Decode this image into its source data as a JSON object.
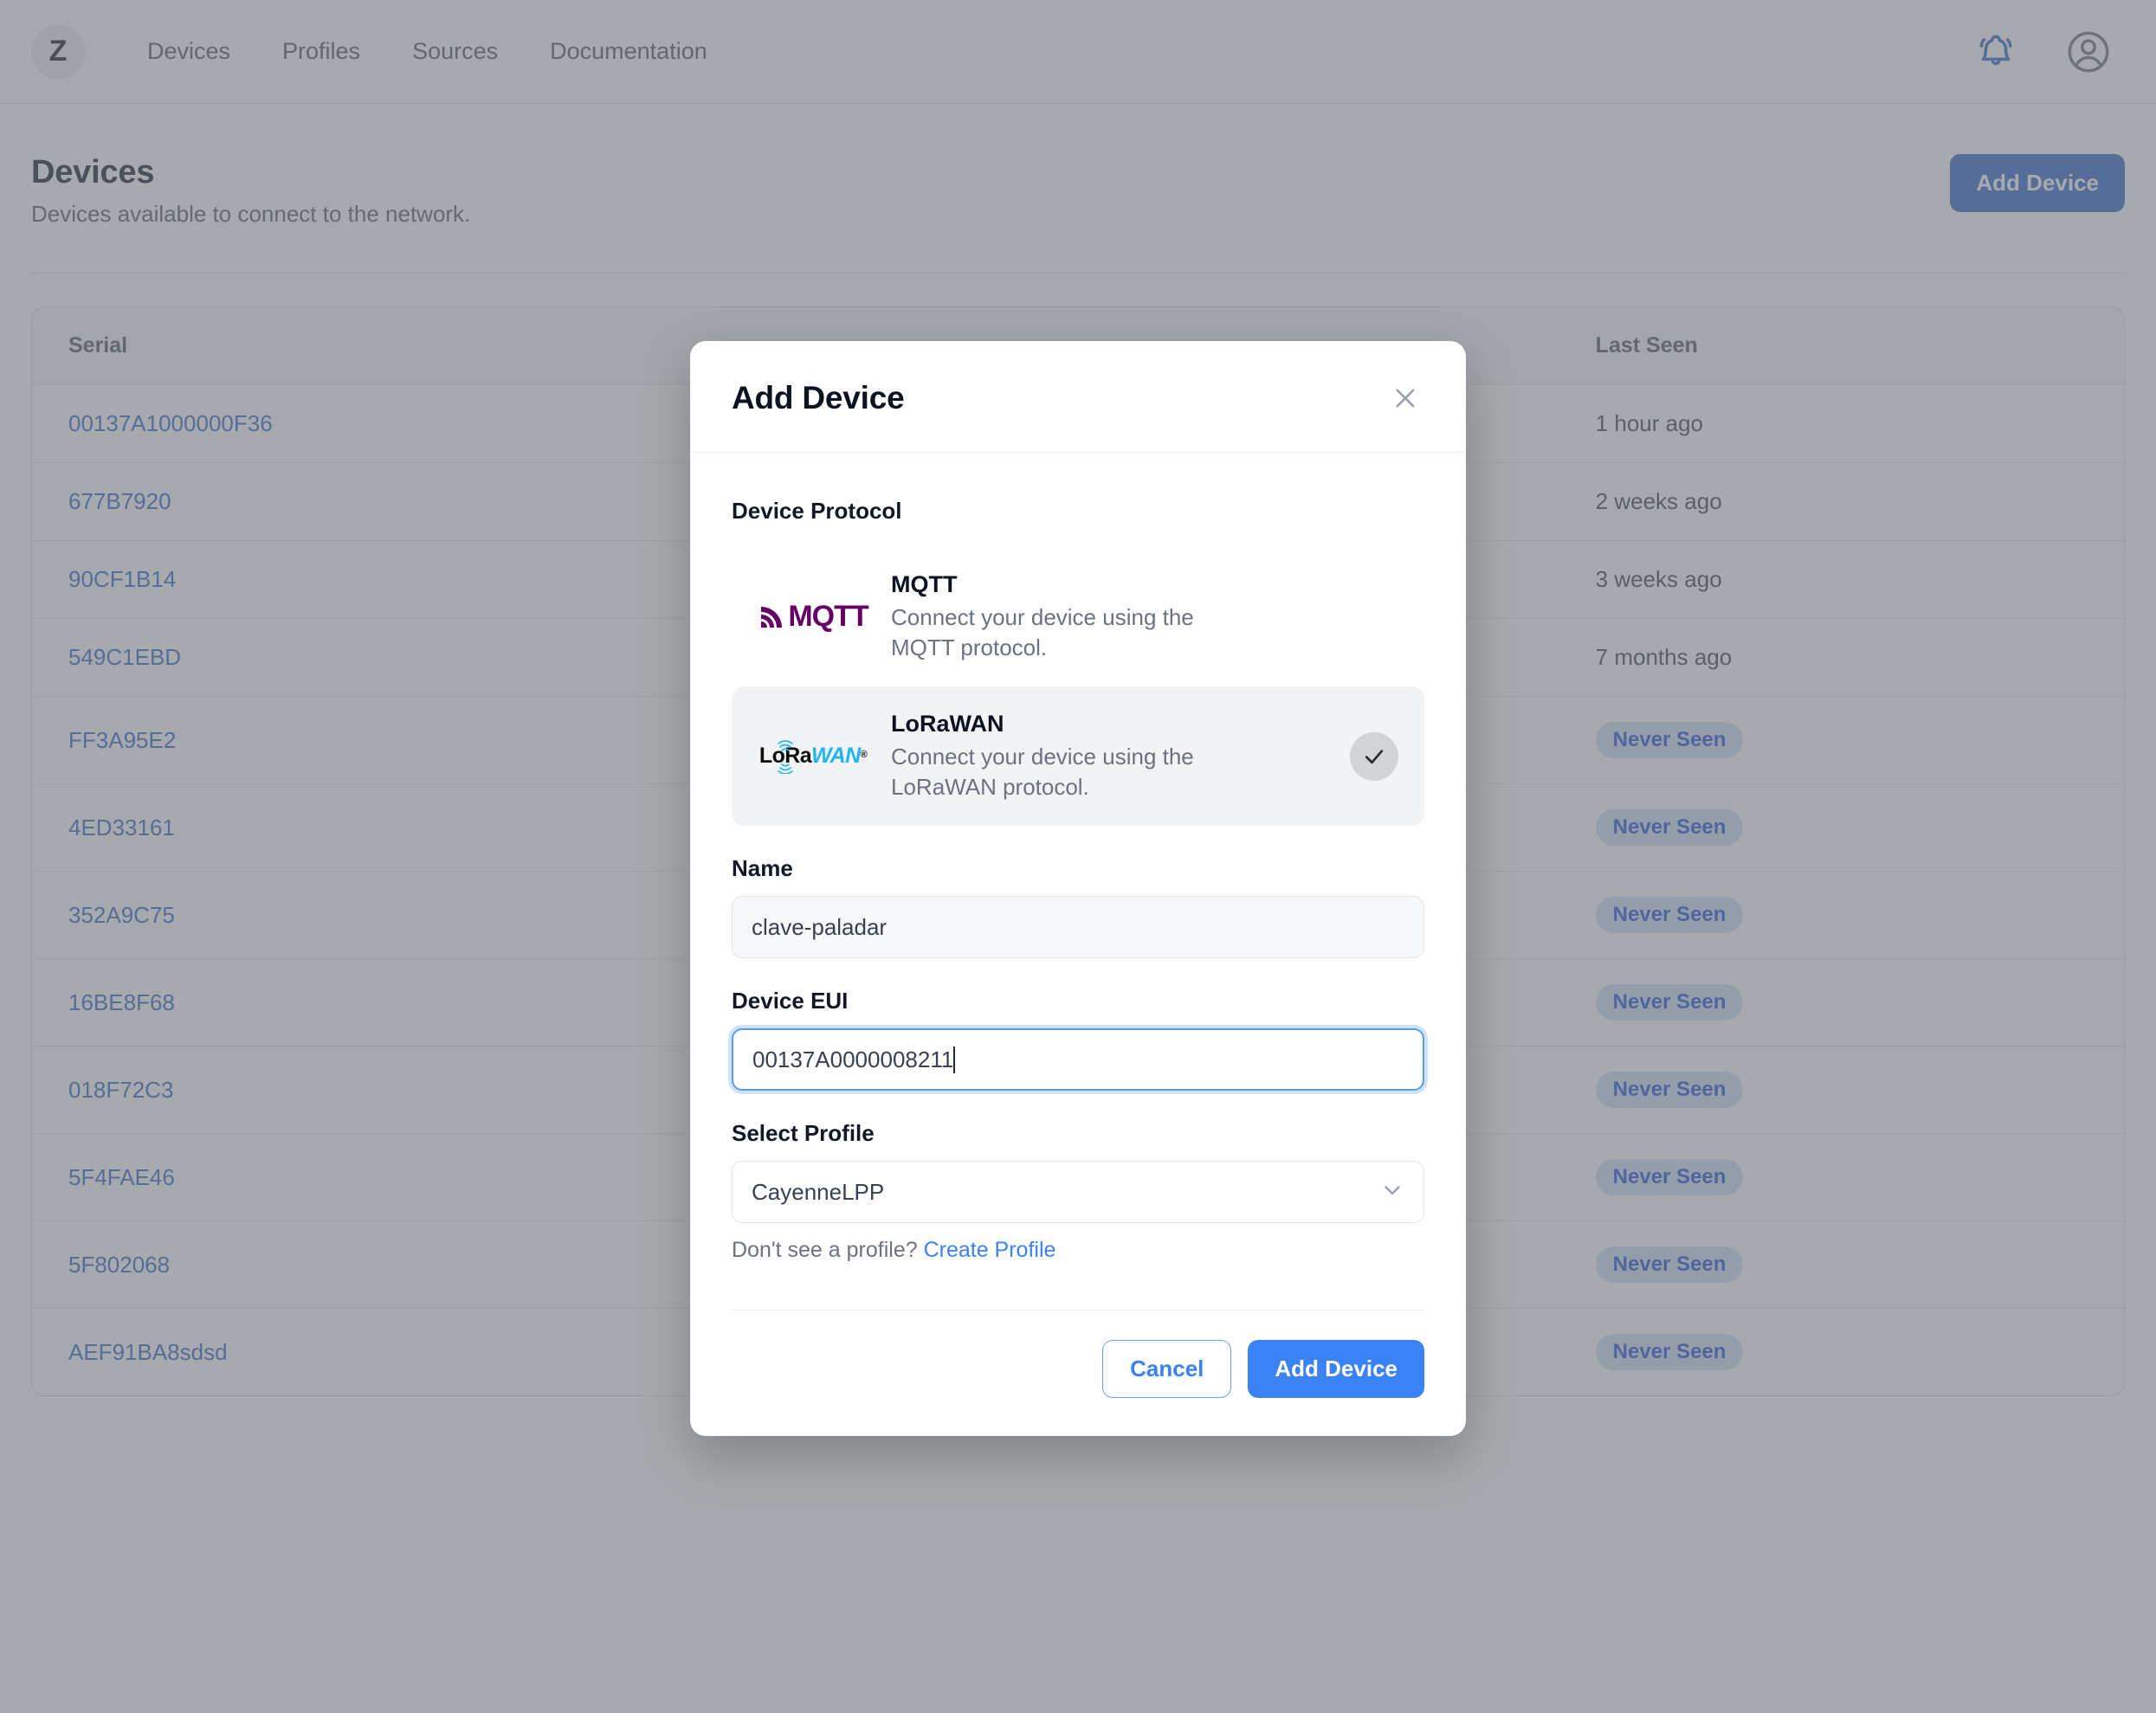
{
  "navbar": {
    "logo_text": "Z",
    "links": [
      {
        "label": "Devices"
      },
      {
        "label": "Profiles"
      },
      {
        "label": "Sources"
      },
      {
        "label": "Documentation"
      }
    ],
    "notifications_icon": "bell-icon",
    "account_icon": "user-circle-icon",
    "notifications_color": "#2f63c4",
    "account_color": "#6b7280"
  },
  "page": {
    "title": "Devices",
    "subtitle": "Devices available to connect to the network.",
    "add_device_label": "Add Device",
    "accent_color": "#2f63c4"
  },
  "table": {
    "columns": [
      "Serial",
      "",
      "Last Seen"
    ],
    "rows": [
      {
        "serial": "00137A1000000F36",
        "last_seen": "1 hour ago",
        "never": false
      },
      {
        "serial": "677B7920",
        "last_seen": "2 weeks ago",
        "never": false
      },
      {
        "serial": "90CF1B14",
        "last_seen": "3 weeks ago",
        "never": false
      },
      {
        "serial": "549C1EBD",
        "last_seen": "7 months ago",
        "never": false
      },
      {
        "serial": "FF3A95E2",
        "last_seen": "Never Seen",
        "never": true
      },
      {
        "serial": "4ED33161",
        "last_seen": "Never Seen",
        "never": true
      },
      {
        "serial": "352A9C75",
        "last_seen": "Never Seen",
        "never": true
      },
      {
        "serial": "16BE8F68",
        "last_seen": "Never Seen",
        "never": true
      },
      {
        "serial": "018F72C3",
        "last_seen": "Never Seen",
        "never": true
      },
      {
        "serial": "5F4FAE46",
        "last_seen": "Never Seen",
        "never": true
      },
      {
        "serial": "5F802068",
        "last_seen": "Never Seen",
        "never": true
      },
      {
        "serial": "AEF91BA8sdsd",
        "last_seen": "Never Seen",
        "never": true
      }
    ],
    "badge_bg": "#cfe0f7",
    "badge_color": "#1d4ed8",
    "link_color": "#2f63c4"
  },
  "modal": {
    "title": "Add Device",
    "close_icon": "close-icon",
    "protocol_label": "Device Protocol",
    "protocols": [
      {
        "name": "MQTT",
        "description": "Connect your device using the MQTT protocol.",
        "logo": "mqtt-logo",
        "logo_color": "#660066",
        "selected": false
      },
      {
        "name": "LoRaWAN",
        "description": "Connect your device using the LoRaWAN protocol.",
        "logo": "lorawan-logo",
        "logo_color": "#21b6ef",
        "selected": true
      }
    ],
    "name_field": {
      "label": "Name",
      "value": "clave-paladar",
      "placeholder": "Name"
    },
    "eui_field": {
      "label": "Device EUI",
      "value": "00137A0000008211",
      "placeholder": "Device EUI",
      "focused": true
    },
    "profile_field": {
      "label": "Select Profile",
      "value": "CayenneLPP",
      "chevron_icon": "chevron-down-icon"
    },
    "helper_text": "Don't see a profile?",
    "helper_link": "Create Profile",
    "cancel_label": "Cancel",
    "submit_label": "Add Device",
    "primary_color": "#3b82f6"
  }
}
